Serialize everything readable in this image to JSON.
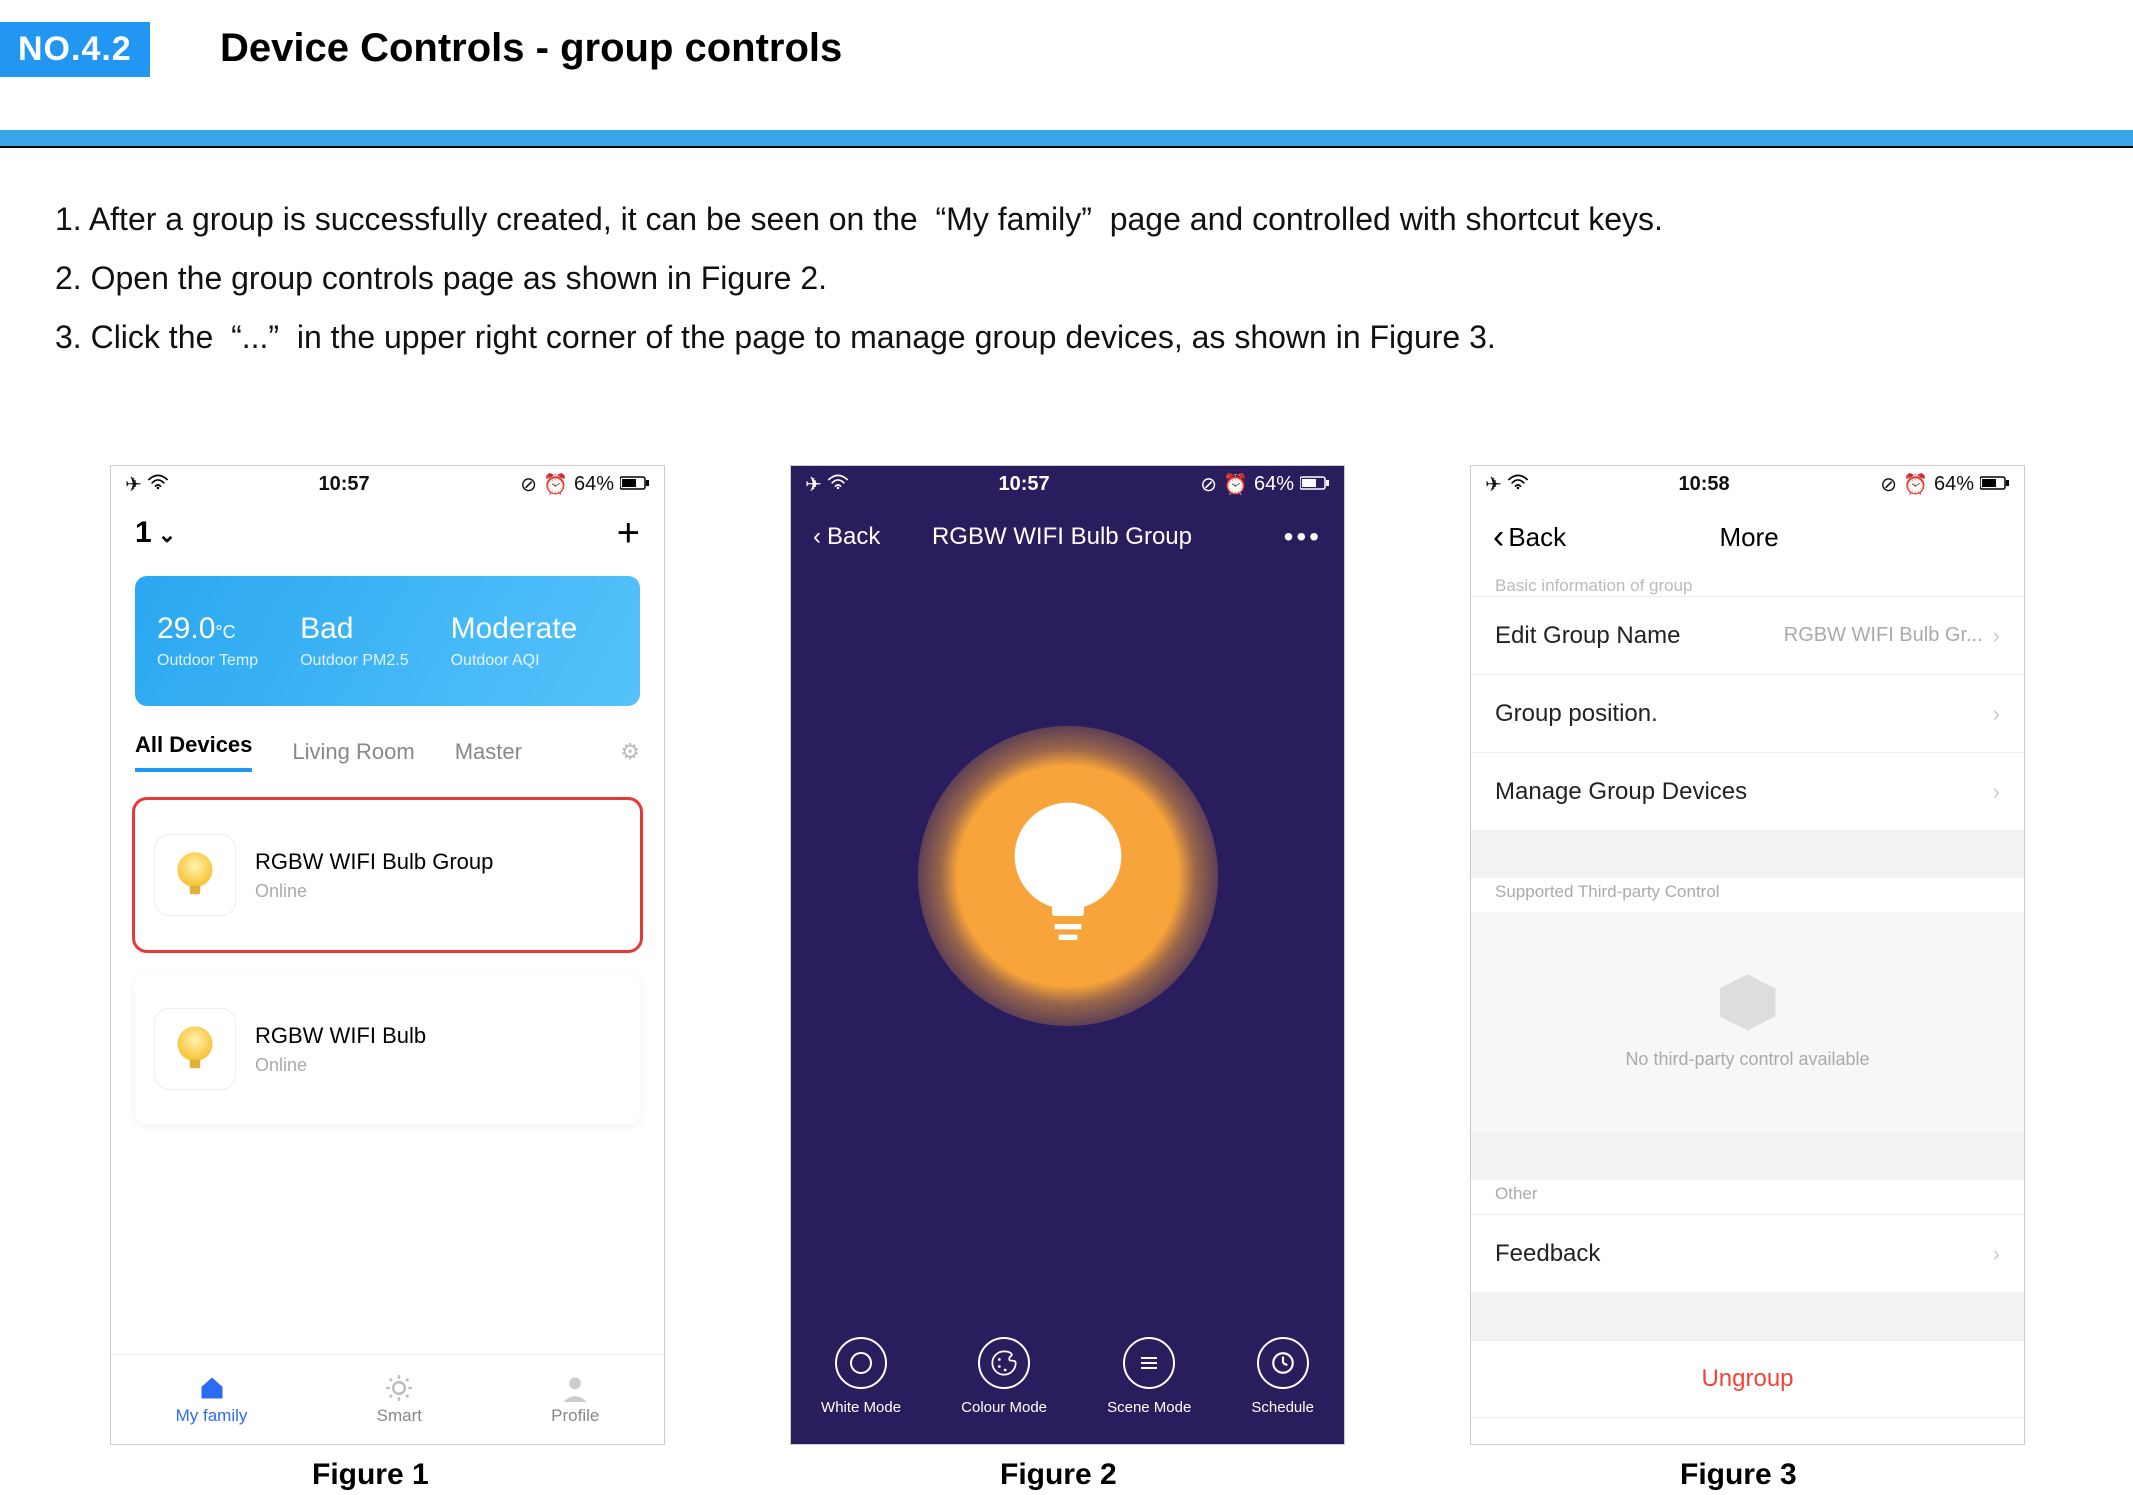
{
  "header": {
    "badge": "NO.4.2",
    "title": "Device Controls - group controls"
  },
  "instructions": [
    "1. After a group is successfully created, it can be seen on the  “My family”  page and controlled with shortcut keys.",
    "2. Open the group controls page as shown in Figure 2.",
    "3. Click the  “...”  in the upper right corner of the page to manage group devices, as shown in Figure 3."
  ],
  "captions": {
    "f1": "Figure 1",
    "f2": "Figure 2",
    "f3": "Figure 3"
  },
  "phone1": {
    "status": {
      "time": "10:57",
      "battery": "64%"
    },
    "home_label": "1",
    "weather": {
      "temp_value": "29.0",
      "temp_unit": "°C",
      "temp_label": "Outdoor Temp",
      "pm_value": "Bad",
      "pm_label": "Outdoor PM2.5",
      "aqi_value": "Moderate",
      "aqi_label": "Outdoor AQI"
    },
    "tabs": {
      "all": "All Devices",
      "living": "Living Room",
      "master": "Master"
    },
    "devices": [
      {
        "name": "RGBW WIFI Bulb Group",
        "status": "Online"
      },
      {
        "name": "RGBW WIFI Bulb",
        "status": "Online"
      }
    ],
    "bottomnav": {
      "family": "My family",
      "smart": "Smart",
      "profile": "Profile"
    }
  },
  "phone2": {
    "status": {
      "time": "10:57",
      "battery": "64%"
    },
    "nav": {
      "back": "Back",
      "title": "RGBW WIFI Bulb Group"
    },
    "modes": {
      "white": "White Mode",
      "colour": "Colour Mode",
      "scene": "Scene Mode",
      "schedule": "Schedule"
    }
  },
  "phone3": {
    "status": {
      "time": "10:58",
      "battery": "64%"
    },
    "nav": {
      "back": "Back",
      "title": "More"
    },
    "section_cut": "Basic information of group",
    "rows": {
      "edit_name_label": "Edit Group Name",
      "edit_name_value": "RGBW WIFI Bulb Gr...",
      "position_label": "Group position.",
      "manage_label": "Manage Group Devices"
    },
    "thirdparty_header": "Supported Third-party Control",
    "thirdparty_empty": "No third-party control available",
    "other_header": "Other",
    "feedback": "Feedback",
    "ungroup": "Ungroup"
  }
}
